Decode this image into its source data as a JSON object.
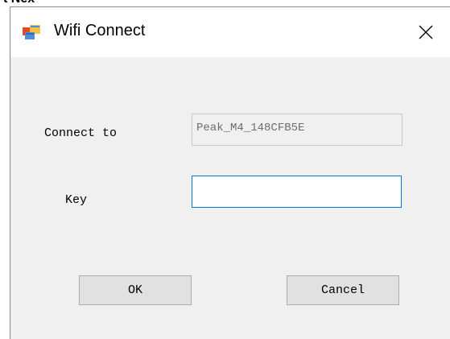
{
  "background_label": "t Nex",
  "dialog": {
    "title": "Wifi Connect",
    "icon": "app-window-icon",
    "close_icon": "close-icon"
  },
  "form": {
    "connect_to_label": "Connect to",
    "connect_to_value": "Peak_M4_148CFB5E",
    "key_label": "Key",
    "key_value": ""
  },
  "buttons": {
    "ok_label": "OK",
    "cancel_label": "Cancel"
  },
  "colors": {
    "dialog_bg": "#f0f0f0",
    "titlebar_bg": "#ffffff",
    "focus_border": "#0078d7",
    "button_bg": "#e1e1e1"
  }
}
